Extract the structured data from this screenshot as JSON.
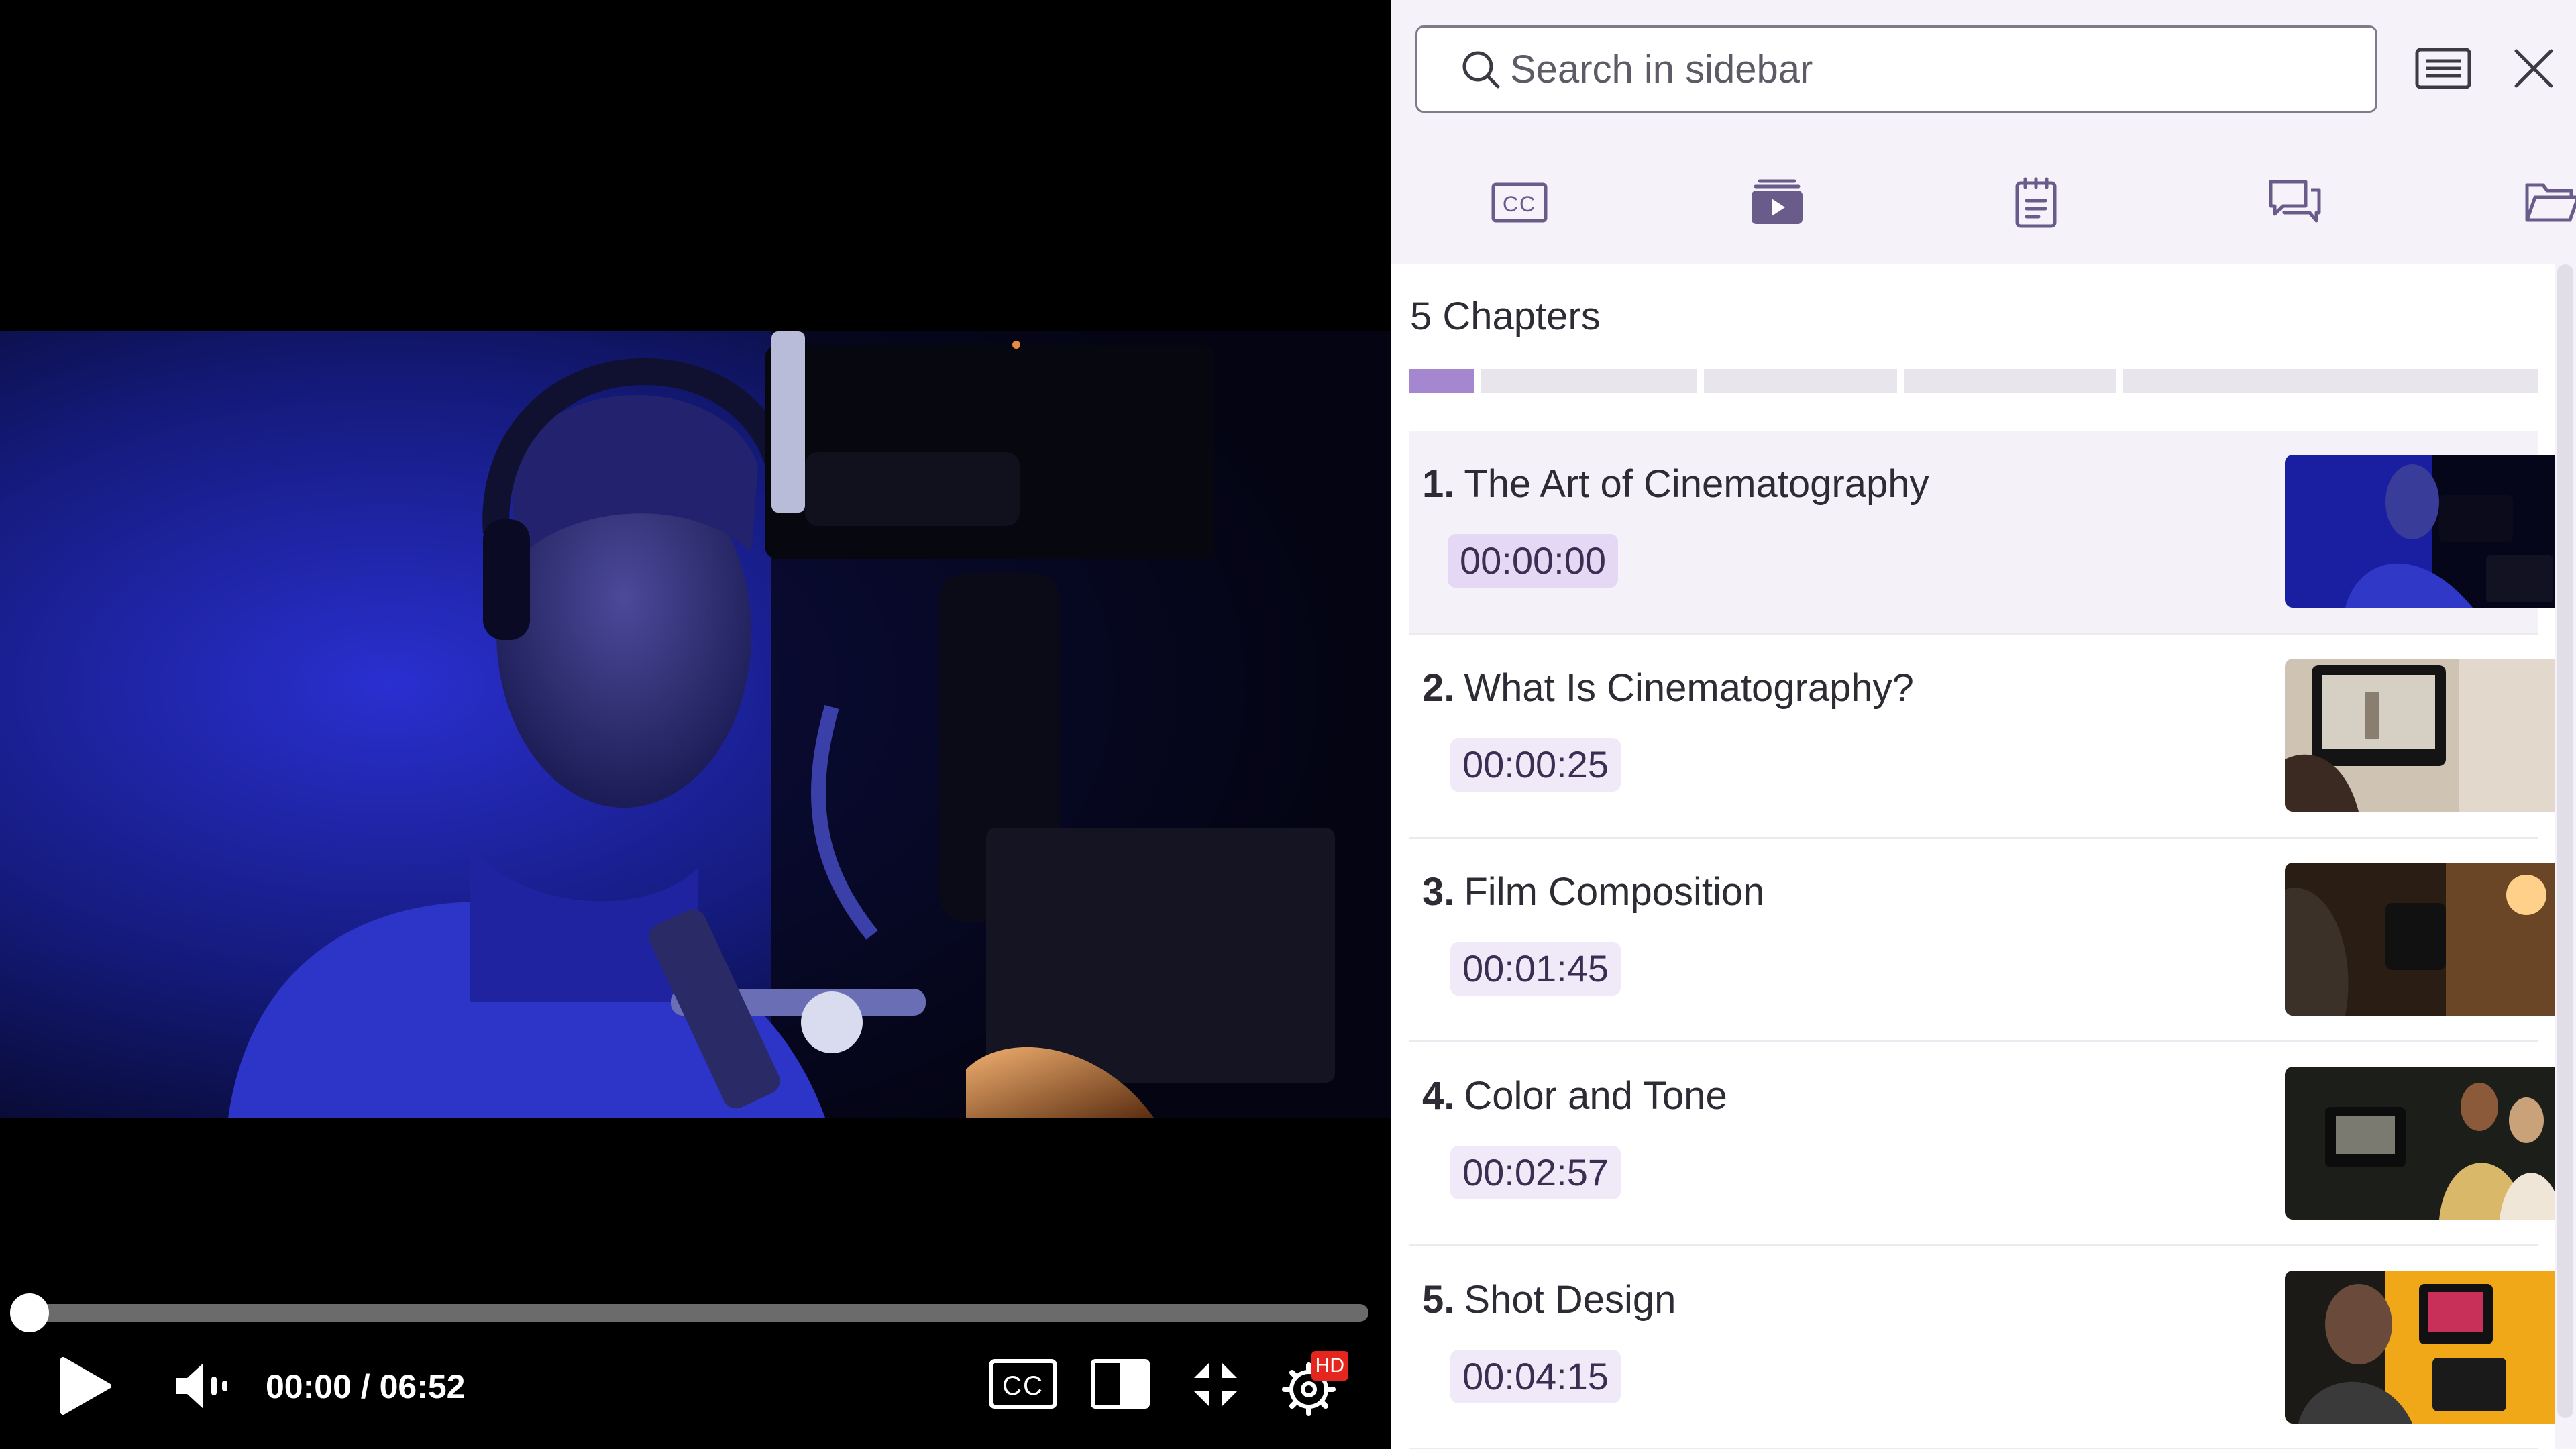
{
  "player": {
    "current_time": "00:00",
    "duration": "06:52",
    "progress": 0.0,
    "hd_badge": "HD",
    "controls": [
      "play-icon",
      "volume-icon",
      "closed-captions-icon",
      "theater-mode-icon",
      "exit-fullscreen-icon",
      "settings-icon"
    ]
  },
  "sidebar": {
    "search": {
      "placeholder": "Search in sidebar",
      "value": ""
    },
    "header_icons": [
      "transcript-icon",
      "close-icon"
    ],
    "tabs": [
      {
        "name": "captions",
        "icon": "closed-captions-icon",
        "active": false
      },
      {
        "name": "chapters",
        "icon": "video-chapters-icon",
        "active": true
      },
      {
        "name": "notes",
        "icon": "notepad-icon",
        "active": false
      },
      {
        "name": "comments",
        "icon": "comments-icon",
        "active": false
      },
      {
        "name": "files",
        "icon": "folder-icon",
        "active": false
      }
    ],
    "chapters_count": "5 Chapters",
    "chapters": [
      {
        "num": "1.",
        "title": "The Art of Cinematography",
        "time": "00:00:00",
        "active": true
      },
      {
        "num": "2.",
        "title": "What Is Cinematography?",
        "time": "00:00:25",
        "active": false
      },
      {
        "num": "3.",
        "title": "Film Composition",
        "time": "00:01:45",
        "active": false
      },
      {
        "num": "4.",
        "title": "Color and Tone",
        "time": "00:02:57",
        "active": false
      },
      {
        "num": "5.",
        "title": "Shot Design",
        "time": "00:04:15",
        "active": false
      }
    ]
  },
  "colors": {
    "accent": "#a487cf",
    "time_badge": "#f0e9f8",
    "sidebar_header_bg": "#f5f2fa",
    "hd_badge": "#e5261f",
    "tab_icon": "#6a5c8a"
  }
}
